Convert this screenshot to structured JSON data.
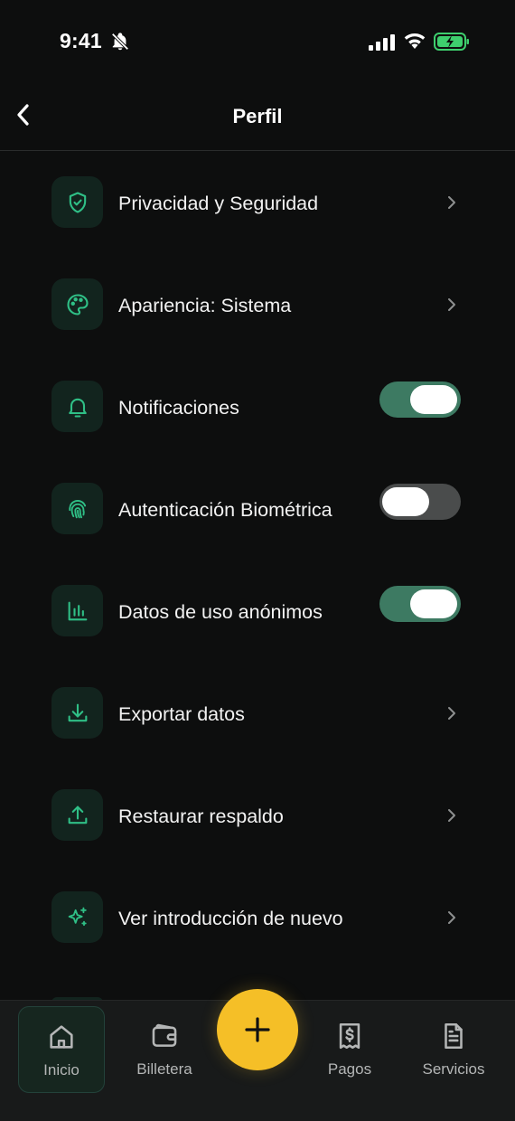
{
  "status_bar": {
    "time": "9:41",
    "icons": [
      "bell-slash-icon",
      "cellular-signal-icon",
      "wifi-icon",
      "battery-charging-icon"
    ]
  },
  "header": {
    "title": "Perfil",
    "back_icon": "chevron-left-icon"
  },
  "menu": {
    "items": [
      {
        "label": "Privacidad y Seguridad",
        "icon": "shield-check-icon",
        "control": "chevron"
      },
      {
        "label": "Apariencia: Sistema",
        "icon": "palette-icon",
        "control": "chevron"
      },
      {
        "label": "Notificaciones",
        "icon": "bell-icon",
        "control": "toggle",
        "enabled": true
      },
      {
        "label": "Autenticación Biométrica",
        "icon": "fingerprint-icon",
        "control": "toggle",
        "enabled": false
      },
      {
        "label": "Datos de uso anónimos",
        "icon": "bar-chart-icon",
        "control": "toggle",
        "enabled": true
      },
      {
        "label": "Exportar datos",
        "icon": "download-icon",
        "control": "chevron"
      },
      {
        "label": "Restaurar respaldo",
        "icon": "upload-icon",
        "control": "chevron"
      },
      {
        "label": "Ver introducción de nuevo",
        "icon": "sparkles-icon",
        "control": "chevron"
      }
    ]
  },
  "tab_bar": {
    "tabs": [
      {
        "label": "Inicio",
        "icon": "home-icon",
        "active": true
      },
      {
        "label": "Billetera",
        "icon": "wallet-icon",
        "active": false
      },
      {
        "label": "Pagos",
        "icon": "receipt-dollar-icon",
        "active": false
      },
      {
        "label": "Servicios",
        "icon": "document-icon",
        "active": false
      }
    ],
    "fab_icon": "plus-icon"
  },
  "colors": {
    "background": "#0d0e0e",
    "accent_green": "#2fbf86",
    "icon_tile": "#12241e",
    "toggle_on": "#3d7a62",
    "toggle_off": "#4a4c4c",
    "fab": "#f5bf27",
    "tab_bar": "#181a1a"
  }
}
